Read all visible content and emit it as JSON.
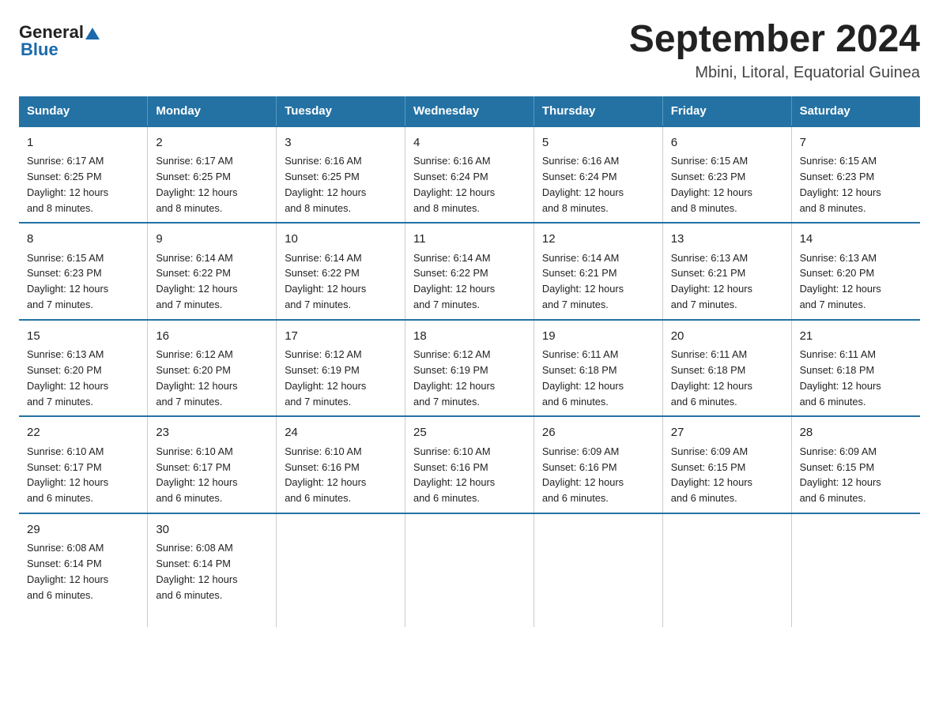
{
  "logo": {
    "general": "General",
    "blue": "Blue"
  },
  "title": "September 2024",
  "subtitle": "Mbini, Litoral, Equatorial Guinea",
  "weekdays": [
    "Sunday",
    "Monday",
    "Tuesday",
    "Wednesday",
    "Thursday",
    "Friday",
    "Saturday"
  ],
  "weeks": [
    [
      {
        "day": "1",
        "info": "Sunrise: 6:17 AM\nSunset: 6:25 PM\nDaylight: 12 hours\nand 8 minutes."
      },
      {
        "day": "2",
        "info": "Sunrise: 6:17 AM\nSunset: 6:25 PM\nDaylight: 12 hours\nand 8 minutes."
      },
      {
        "day": "3",
        "info": "Sunrise: 6:16 AM\nSunset: 6:25 PM\nDaylight: 12 hours\nand 8 minutes."
      },
      {
        "day": "4",
        "info": "Sunrise: 6:16 AM\nSunset: 6:24 PM\nDaylight: 12 hours\nand 8 minutes."
      },
      {
        "day": "5",
        "info": "Sunrise: 6:16 AM\nSunset: 6:24 PM\nDaylight: 12 hours\nand 8 minutes."
      },
      {
        "day": "6",
        "info": "Sunrise: 6:15 AM\nSunset: 6:23 PM\nDaylight: 12 hours\nand 8 minutes."
      },
      {
        "day": "7",
        "info": "Sunrise: 6:15 AM\nSunset: 6:23 PM\nDaylight: 12 hours\nand 8 minutes."
      }
    ],
    [
      {
        "day": "8",
        "info": "Sunrise: 6:15 AM\nSunset: 6:23 PM\nDaylight: 12 hours\nand 7 minutes."
      },
      {
        "day": "9",
        "info": "Sunrise: 6:14 AM\nSunset: 6:22 PM\nDaylight: 12 hours\nand 7 minutes."
      },
      {
        "day": "10",
        "info": "Sunrise: 6:14 AM\nSunset: 6:22 PM\nDaylight: 12 hours\nand 7 minutes."
      },
      {
        "day": "11",
        "info": "Sunrise: 6:14 AM\nSunset: 6:22 PM\nDaylight: 12 hours\nand 7 minutes."
      },
      {
        "day": "12",
        "info": "Sunrise: 6:14 AM\nSunset: 6:21 PM\nDaylight: 12 hours\nand 7 minutes."
      },
      {
        "day": "13",
        "info": "Sunrise: 6:13 AM\nSunset: 6:21 PM\nDaylight: 12 hours\nand 7 minutes."
      },
      {
        "day": "14",
        "info": "Sunrise: 6:13 AM\nSunset: 6:20 PM\nDaylight: 12 hours\nand 7 minutes."
      }
    ],
    [
      {
        "day": "15",
        "info": "Sunrise: 6:13 AM\nSunset: 6:20 PM\nDaylight: 12 hours\nand 7 minutes."
      },
      {
        "day": "16",
        "info": "Sunrise: 6:12 AM\nSunset: 6:20 PM\nDaylight: 12 hours\nand 7 minutes."
      },
      {
        "day": "17",
        "info": "Sunrise: 6:12 AM\nSunset: 6:19 PM\nDaylight: 12 hours\nand 7 minutes."
      },
      {
        "day": "18",
        "info": "Sunrise: 6:12 AM\nSunset: 6:19 PM\nDaylight: 12 hours\nand 7 minutes."
      },
      {
        "day": "19",
        "info": "Sunrise: 6:11 AM\nSunset: 6:18 PM\nDaylight: 12 hours\nand 6 minutes."
      },
      {
        "day": "20",
        "info": "Sunrise: 6:11 AM\nSunset: 6:18 PM\nDaylight: 12 hours\nand 6 minutes."
      },
      {
        "day": "21",
        "info": "Sunrise: 6:11 AM\nSunset: 6:18 PM\nDaylight: 12 hours\nand 6 minutes."
      }
    ],
    [
      {
        "day": "22",
        "info": "Sunrise: 6:10 AM\nSunset: 6:17 PM\nDaylight: 12 hours\nand 6 minutes."
      },
      {
        "day": "23",
        "info": "Sunrise: 6:10 AM\nSunset: 6:17 PM\nDaylight: 12 hours\nand 6 minutes."
      },
      {
        "day": "24",
        "info": "Sunrise: 6:10 AM\nSunset: 6:16 PM\nDaylight: 12 hours\nand 6 minutes."
      },
      {
        "day": "25",
        "info": "Sunrise: 6:10 AM\nSunset: 6:16 PM\nDaylight: 12 hours\nand 6 minutes."
      },
      {
        "day": "26",
        "info": "Sunrise: 6:09 AM\nSunset: 6:16 PM\nDaylight: 12 hours\nand 6 minutes."
      },
      {
        "day": "27",
        "info": "Sunrise: 6:09 AM\nSunset: 6:15 PM\nDaylight: 12 hours\nand 6 minutes."
      },
      {
        "day": "28",
        "info": "Sunrise: 6:09 AM\nSunset: 6:15 PM\nDaylight: 12 hours\nand 6 minutes."
      }
    ],
    [
      {
        "day": "29",
        "info": "Sunrise: 6:08 AM\nSunset: 6:14 PM\nDaylight: 12 hours\nand 6 minutes."
      },
      {
        "day": "30",
        "info": "Sunrise: 6:08 AM\nSunset: 6:14 PM\nDaylight: 12 hours\nand 6 minutes."
      },
      {
        "day": "",
        "info": ""
      },
      {
        "day": "",
        "info": ""
      },
      {
        "day": "",
        "info": ""
      },
      {
        "day": "",
        "info": ""
      },
      {
        "day": "",
        "info": ""
      }
    ]
  ]
}
